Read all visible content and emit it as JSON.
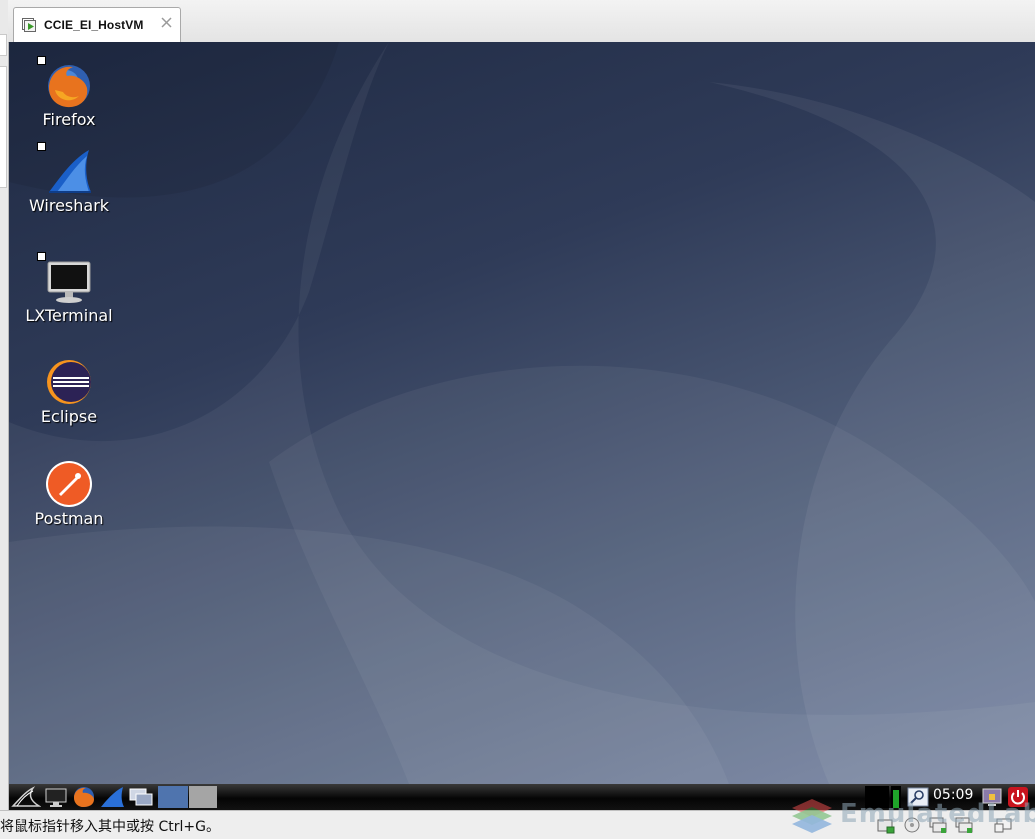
{
  "host": {
    "tab": {
      "title": "CCIE_EI_HostVM",
      "icon": "vm-play-icon",
      "close_icon": "close-icon"
    },
    "status_text": "将鼠标指针移入其中或按 Ctrl+G。",
    "status_icons": [
      "hard-disk-icon",
      "cd-rom-icon",
      "network-adapter-icon",
      "network-adapter-icon",
      "display-icon"
    ],
    "watermark": "EmulatedLab"
  },
  "desktop": {
    "icons": [
      {
        "label": "Firefox",
        "icon": "firefox-icon",
        "shortcut": true
      },
      {
        "label": "Wireshark",
        "icon": "wireshark-icon",
        "shortcut": true
      },
      {
        "label": "LXTerminal",
        "icon": "terminal-icon",
        "shortcut": true
      },
      {
        "label": "Eclipse",
        "icon": "eclipse-icon",
        "shortcut": false
      },
      {
        "label": "Postman",
        "icon": "postman-icon",
        "shortcut": false
      }
    ]
  },
  "taskbar": {
    "launchers": [
      "start-menu-icon",
      "show-desktop-icon",
      "firefox-icon",
      "wireshark-icon",
      "window-switcher-icon"
    ],
    "workspaces": [
      "workspace-1",
      "workspace-2"
    ],
    "tray": [
      "cpu-monitor-icon",
      "network-monitor-icon"
    ],
    "clock": "05:09",
    "right_buttons": [
      "lock-screen-icon",
      "power-icon"
    ]
  },
  "colors": {
    "desktop_dark": "#1f2a43",
    "desktop_light": "#7482a0",
    "taskbar": "#111111",
    "tab_bg": "#ffffff"
  }
}
